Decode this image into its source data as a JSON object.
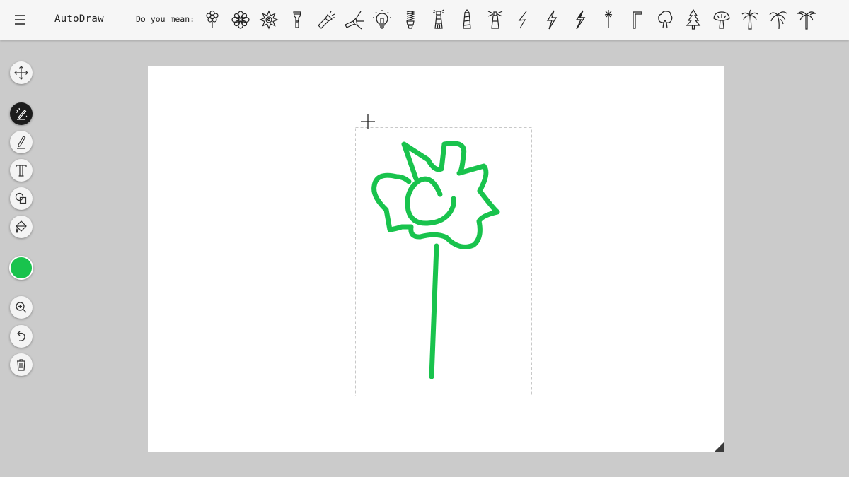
{
  "app": {
    "title": "AutoDraw"
  },
  "suggestions": {
    "label": "Do you mean:",
    "items": [
      "flower-outline-icon",
      "flower-mandala-icon",
      "flower-sunflower-icon",
      "flashlight-icon",
      "flashlight-beam-icon",
      "flashlight-angled-icon",
      "lightbulb-icon",
      "cfl-lightbulb-icon",
      "lighthouse-icon",
      "lighthouse-striped-icon",
      "lighthouse-beam-icon",
      "lightning-bolt-thin-icon",
      "lightning-bolt-icon",
      "lightning-bolt-bold-icon",
      "sparkler-icon",
      "hex-key-icon",
      "tree-round-icon",
      "pine-tree-icon",
      "mushroom-tree-icon",
      "palm-tree-icon",
      "palm-tree-wide-icon",
      "palm-tree-tall-icon"
    ]
  },
  "toolbar": {
    "tools": [
      {
        "name": "move-tool",
        "icon": "move-icon"
      },
      {
        "name": "autodraw-tool",
        "icon": "autodraw-icon",
        "active": true
      },
      {
        "name": "draw-tool",
        "icon": "pencil-icon"
      },
      {
        "name": "type-tool",
        "icon": "text-icon"
      },
      {
        "name": "shape-tool",
        "icon": "shapes-icon"
      },
      {
        "name": "fill-tool",
        "icon": "paint-bucket-icon"
      },
      {
        "name": "zoom-tool",
        "icon": "zoom-in-icon"
      },
      {
        "name": "undo-tool",
        "icon": "undo-icon"
      },
      {
        "name": "delete-tool",
        "icon": "trash-icon"
      }
    ],
    "selected_color": "#19c34d"
  },
  "canvas": {
    "stroke_color": "#19c34d",
    "background": "#ffffff",
    "drawing": "flower-sketch"
  }
}
